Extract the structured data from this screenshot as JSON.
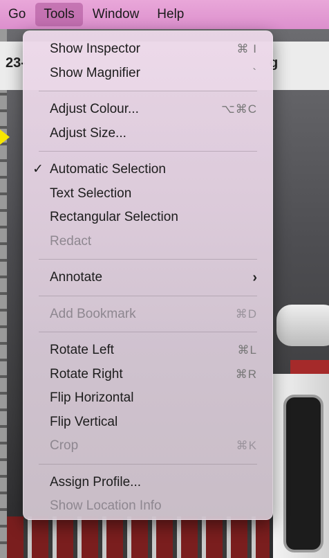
{
  "menubar": {
    "items": [
      {
        "label": "Go"
      },
      {
        "label": "Tools"
      },
      {
        "label": "Window"
      },
      {
        "label": "Help"
      }
    ]
  },
  "background": {
    "title_left": "23-",
    "title_right": "g"
  },
  "tools_menu": {
    "groups": [
      [
        {
          "label": "Show Inspector",
          "shortcut": "⌘ I",
          "enabled": true
        },
        {
          "label": "Show Magnifier",
          "shortcut": "`",
          "enabled": true
        }
      ],
      [
        {
          "label": "Adjust Colour...",
          "shortcut": "⌥⌘C",
          "enabled": true
        },
        {
          "label": "Adjust Size...",
          "shortcut": "",
          "enabled": true
        }
      ],
      [
        {
          "label": "Automatic Selection",
          "shortcut": "",
          "enabled": true,
          "checked": true
        },
        {
          "label": "Text Selection",
          "shortcut": "",
          "enabled": true
        },
        {
          "label": "Rectangular Selection",
          "shortcut": "",
          "enabled": true
        },
        {
          "label": "Redact",
          "shortcut": "",
          "enabled": false
        }
      ],
      [
        {
          "label": "Annotate",
          "shortcut": "",
          "enabled": true,
          "submenu": true
        }
      ],
      [
        {
          "label": "Add Bookmark",
          "shortcut": "⌘D",
          "enabled": false
        }
      ],
      [
        {
          "label": "Rotate Left",
          "shortcut": "⌘L",
          "enabled": true
        },
        {
          "label": "Rotate Right",
          "shortcut": "⌘R",
          "enabled": true
        },
        {
          "label": "Flip Horizontal",
          "shortcut": "",
          "enabled": true
        },
        {
          "label": "Flip Vertical",
          "shortcut": "",
          "enabled": true
        },
        {
          "label": "Crop",
          "shortcut": "⌘K",
          "enabled": false
        }
      ],
      [
        {
          "label": "Assign Profile...",
          "shortcut": "",
          "enabled": true
        },
        {
          "label": "Show Location Info",
          "shortcut": "",
          "enabled": false
        }
      ]
    ],
    "checkmark": "✓",
    "submenu_arrow": ">"
  }
}
